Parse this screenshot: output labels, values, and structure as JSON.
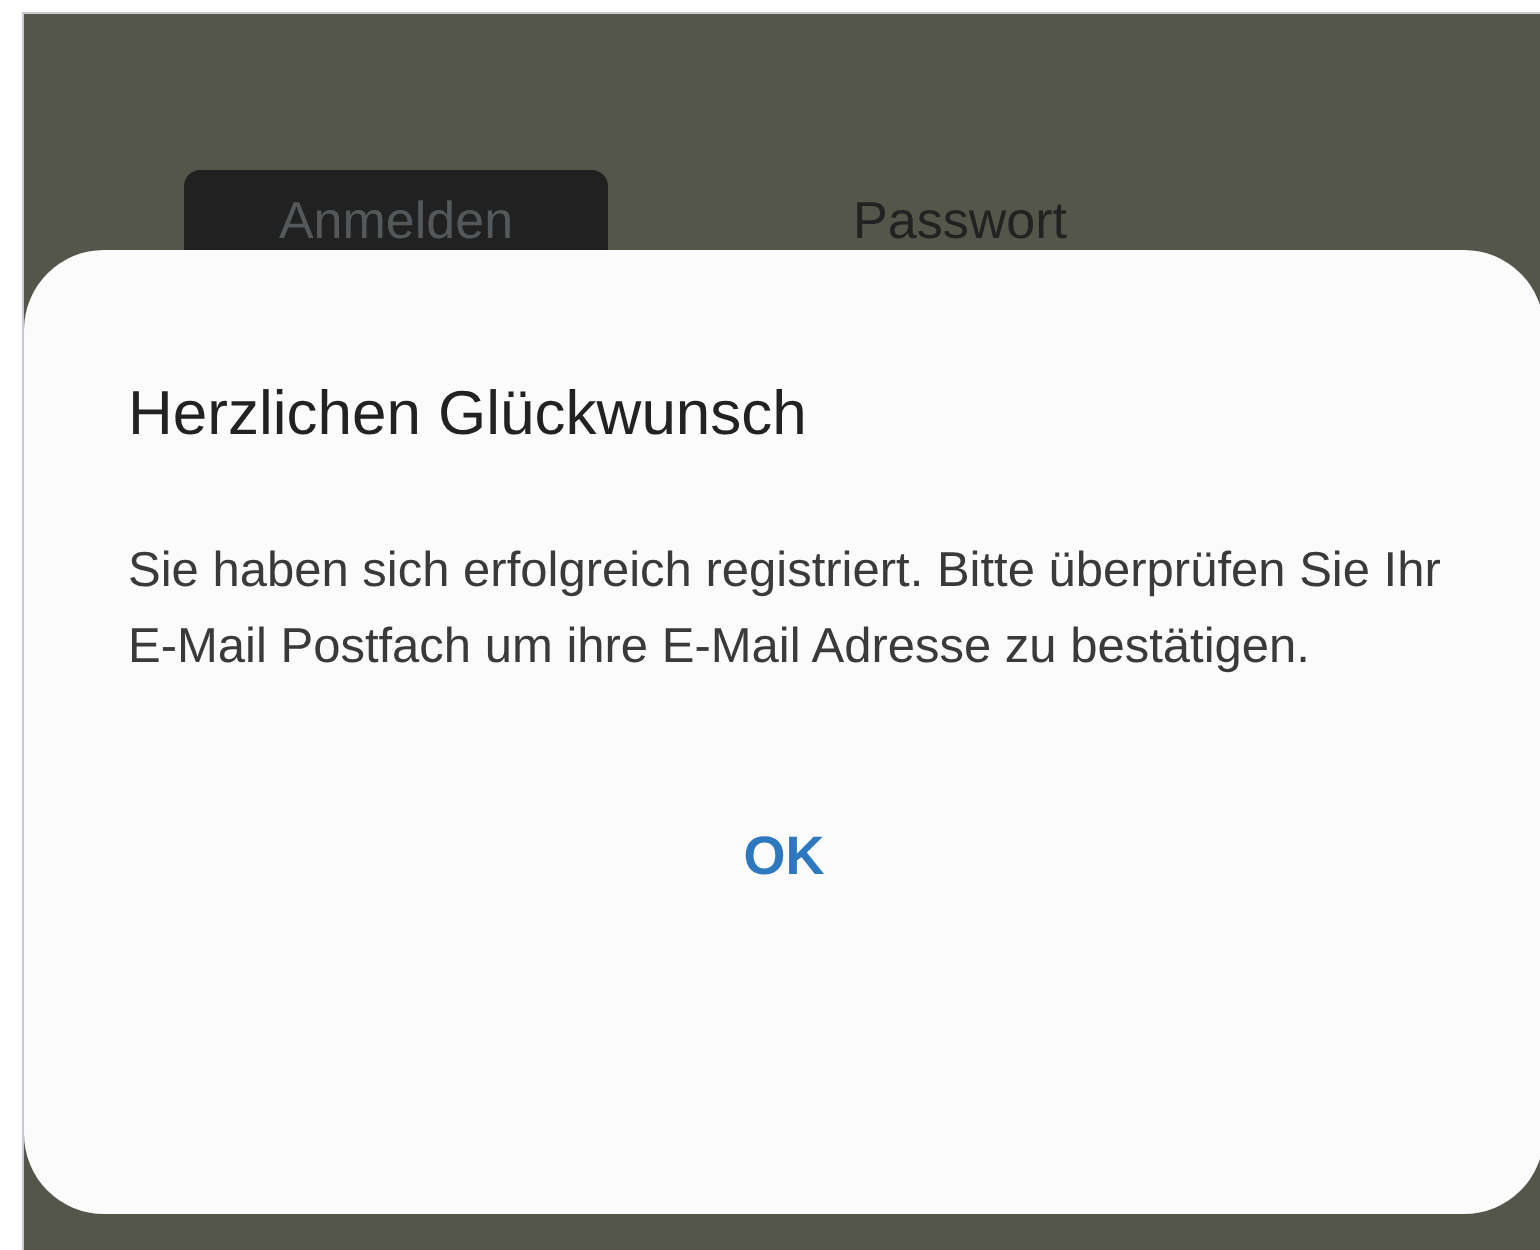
{
  "tabs": [
    {
      "label": "Anmelden",
      "selected": true
    },
    {
      "label": "Passwort",
      "selected": false
    }
  ],
  "dialog": {
    "title": "Herzlichen Glückwunsch",
    "message": "Sie haben sich erfolgreich registriert. Bitte überprüfen Sie Ihr E-Mail Postfach um ihre E-Mail Adresse zu bestätigen.",
    "button": "OK"
  }
}
